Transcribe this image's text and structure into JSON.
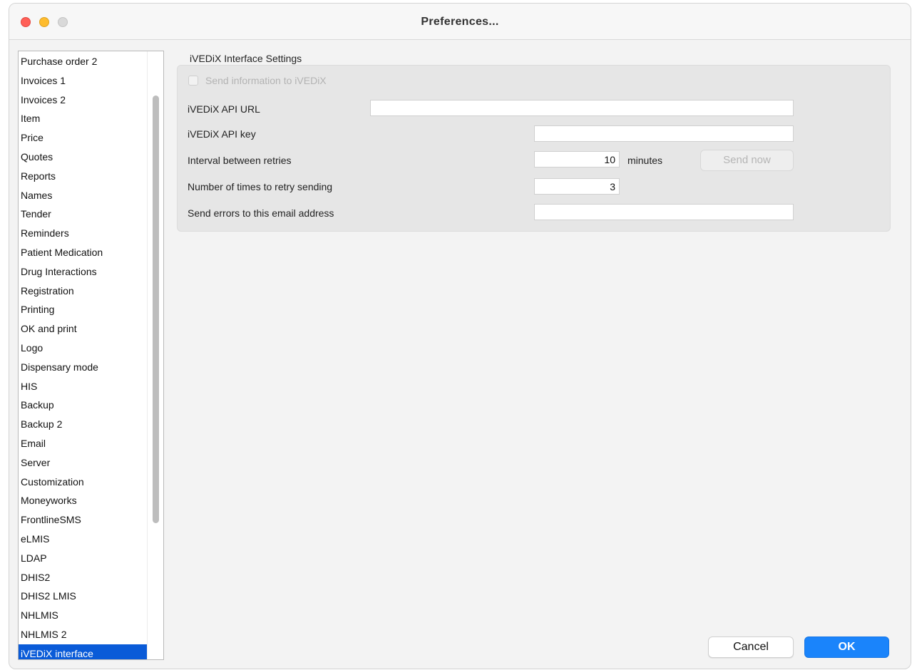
{
  "window": {
    "title": "Preferences..."
  },
  "sidebar": {
    "items": [
      "Purchase order 2",
      "Invoices 1",
      "Invoices 2",
      "Item",
      "Price",
      "Quotes",
      "Reports",
      "Names",
      "Tender",
      "Reminders",
      "Patient Medication",
      "Drug Interactions",
      "Registration",
      "Printing",
      "OK and print",
      "Logo",
      "Dispensary mode",
      "HIS",
      "Backup",
      "Backup 2",
      "Email",
      "Server",
      "Customization",
      "Moneyworks",
      "FrontlineSMS",
      "eLMIS",
      "LDAP",
      "DHIS2",
      "DHIS2 LMIS",
      "NHLMIS",
      "NHLMIS 2",
      "iVEDiX interface"
    ],
    "selected": "iVEDiX interface"
  },
  "settings": {
    "section_title": "iVEDiX Interface Settings",
    "send_info_label": "Send information to iVEDiX",
    "send_info_checked": false,
    "api_url_label": "iVEDiX API URL",
    "api_url_value": "",
    "api_key_label": "iVEDiX API key",
    "api_key_value": "",
    "retry_interval_label": "Interval between retries",
    "retry_interval_value": "10",
    "retry_interval_unit": "minutes",
    "send_now_label": "Send now",
    "retry_count_label": "Number of times to retry sending",
    "retry_count_value": "3",
    "error_email_label": "Send errors to this email address",
    "error_email_value": ""
  },
  "footer": {
    "cancel_label": "Cancel",
    "ok_label": "OK"
  },
  "colors": {
    "selection": "#0a5bd8",
    "ok_button": "#1a84fb",
    "close_light": "#ff5f57",
    "minimize_light": "#febc2e",
    "zoom_light": "#d9d9d9"
  }
}
